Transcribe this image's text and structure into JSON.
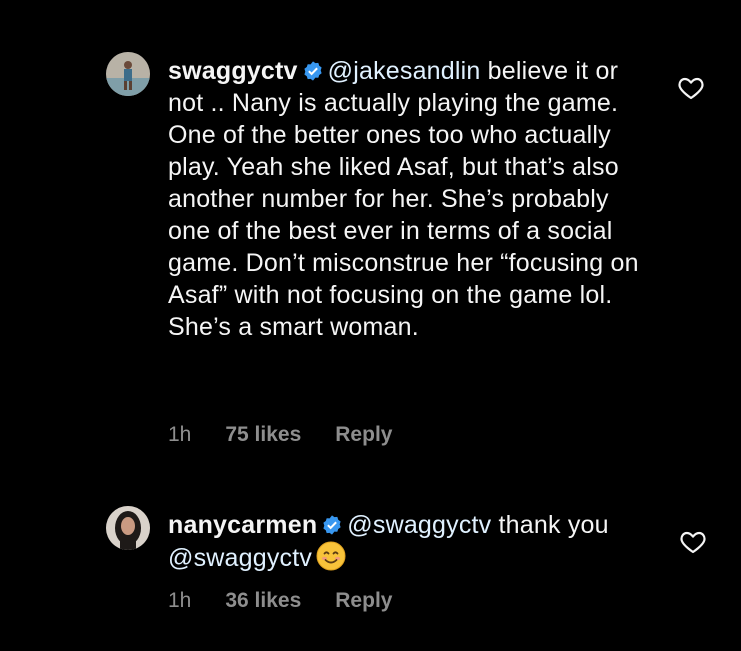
{
  "comments": [
    {
      "username": "swaggyctv",
      "mention": "@jakesandlin",
      "text": " believe it or not .. Nany is actually playing the game. One of the better ones too who actually play. Yeah she liked Asaf, but that’s also another number for her. She’s probably one of the best ever in terms of a social game. Don’t misconstrue her “focusing on Asaf” with not focusing on the game lol. She’s a smart woman.",
      "time": "1h",
      "likes": "75 likes",
      "reply": "Reply",
      "avatar_icon": "avatar-photo",
      "verified_icon": "verified-badge-icon"
    },
    {
      "username": "nanycarmen",
      "mention": "@swaggyctv",
      "text_a": " thank you ",
      "mention_b": "@swaggyctv",
      "emoji": "smiling-face-emoji",
      "time": "1h",
      "likes": "36 likes",
      "reply": "Reply",
      "avatar_icon": "avatar-photo",
      "verified_icon": "verified-badge-icon"
    }
  ],
  "colors": {
    "background": "#000000",
    "text": "#f5f5f5",
    "meta": "#8e8e8e",
    "verified": "#3897f0"
  }
}
